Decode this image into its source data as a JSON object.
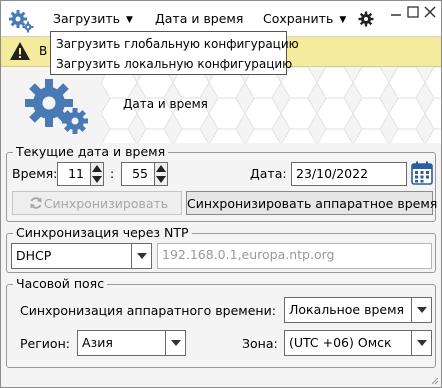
{
  "menu": {
    "load_label": "Загрузить",
    "datetime_label": "Дата и время",
    "save_label": "Сохранить"
  },
  "load_menu": {
    "items": [
      "Загрузить глобальную конфигурацию",
      "Загрузить локальную конфигурацию"
    ]
  },
  "warning": {
    "visible_text": "В"
  },
  "banner": {
    "title": "Дата и время"
  },
  "current_datetime": {
    "group_title": "Текущие дата и время",
    "time_label": "Время:",
    "hour": "11",
    "minute": "55",
    "date_label": "Дата:",
    "date_value": "23/10/2022",
    "sync_button": "Синхронизировать",
    "sync_hw_button": "Синхронизировать аппаратное время"
  },
  "ntp": {
    "group_title": "Синхронизация через NTP",
    "mode": "DHCP",
    "servers": "192.168.0.1,europa.ntp.org"
  },
  "timezone": {
    "group_title": "Часовой пояс",
    "hw_sync_label": "Синхронизация аппаратного времени:",
    "hw_sync_value": "Локальное время",
    "region_label": "Регион:",
    "region_value": "Азия",
    "zone_label": "Зона:",
    "zone_value": "(UTC +06) Омск"
  },
  "colors": {
    "accent_blue": "#4a7ab5",
    "warning_bg": "#f4eb9c"
  }
}
